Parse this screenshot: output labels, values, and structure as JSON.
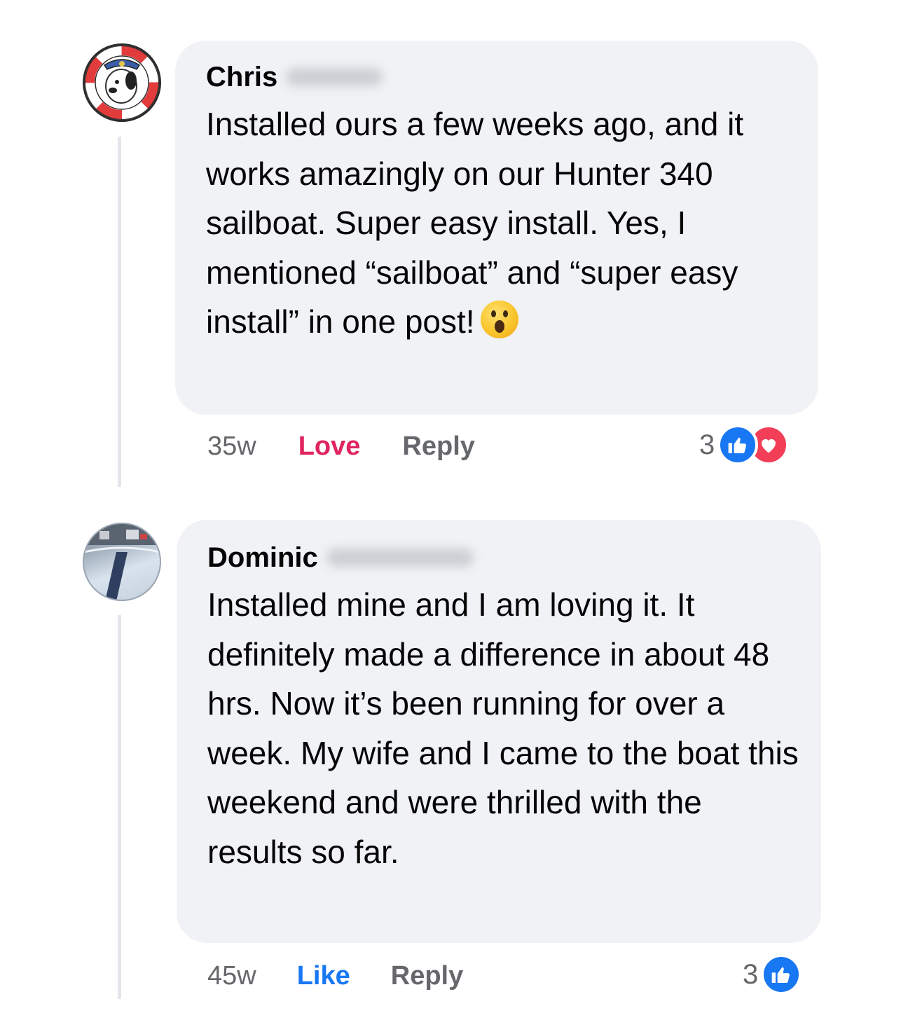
{
  "comments": [
    {
      "author": "Chris",
      "text": "Installed ours a few weeks ago, and it works amazingly on our Hunter 340 sailboat. Super easy install. Yes, I mentioned “sailboat” and “super easy install” in one post!",
      "emoji": "astonished-face-icon",
      "time": "35w",
      "reaction_action": "Love",
      "reply_label": "Reply",
      "reaction_count": "3",
      "reaction_icons": [
        "like-icon",
        "love-icon"
      ],
      "colors": {
        "action": "#e0245e"
      }
    },
    {
      "author": "Dominic",
      "text": "Installed mine and I am loving it. It definitely made a difference in about 48 hrs. Now it’s been running for over a week. My wife and I came to the boat this weekend and were thrilled with the results so far.",
      "time": "45w",
      "reaction_action": "Like",
      "reply_label": "Reply",
      "reaction_count": "3",
      "reaction_icons": [
        "like-icon"
      ],
      "colors": {
        "action": "#1877f2"
      }
    }
  ],
  "colors": {
    "bubble": "#f0f2f5",
    "meta": "#65676b",
    "like_blue": "#1877f2",
    "love_red": "#f33e58"
  }
}
